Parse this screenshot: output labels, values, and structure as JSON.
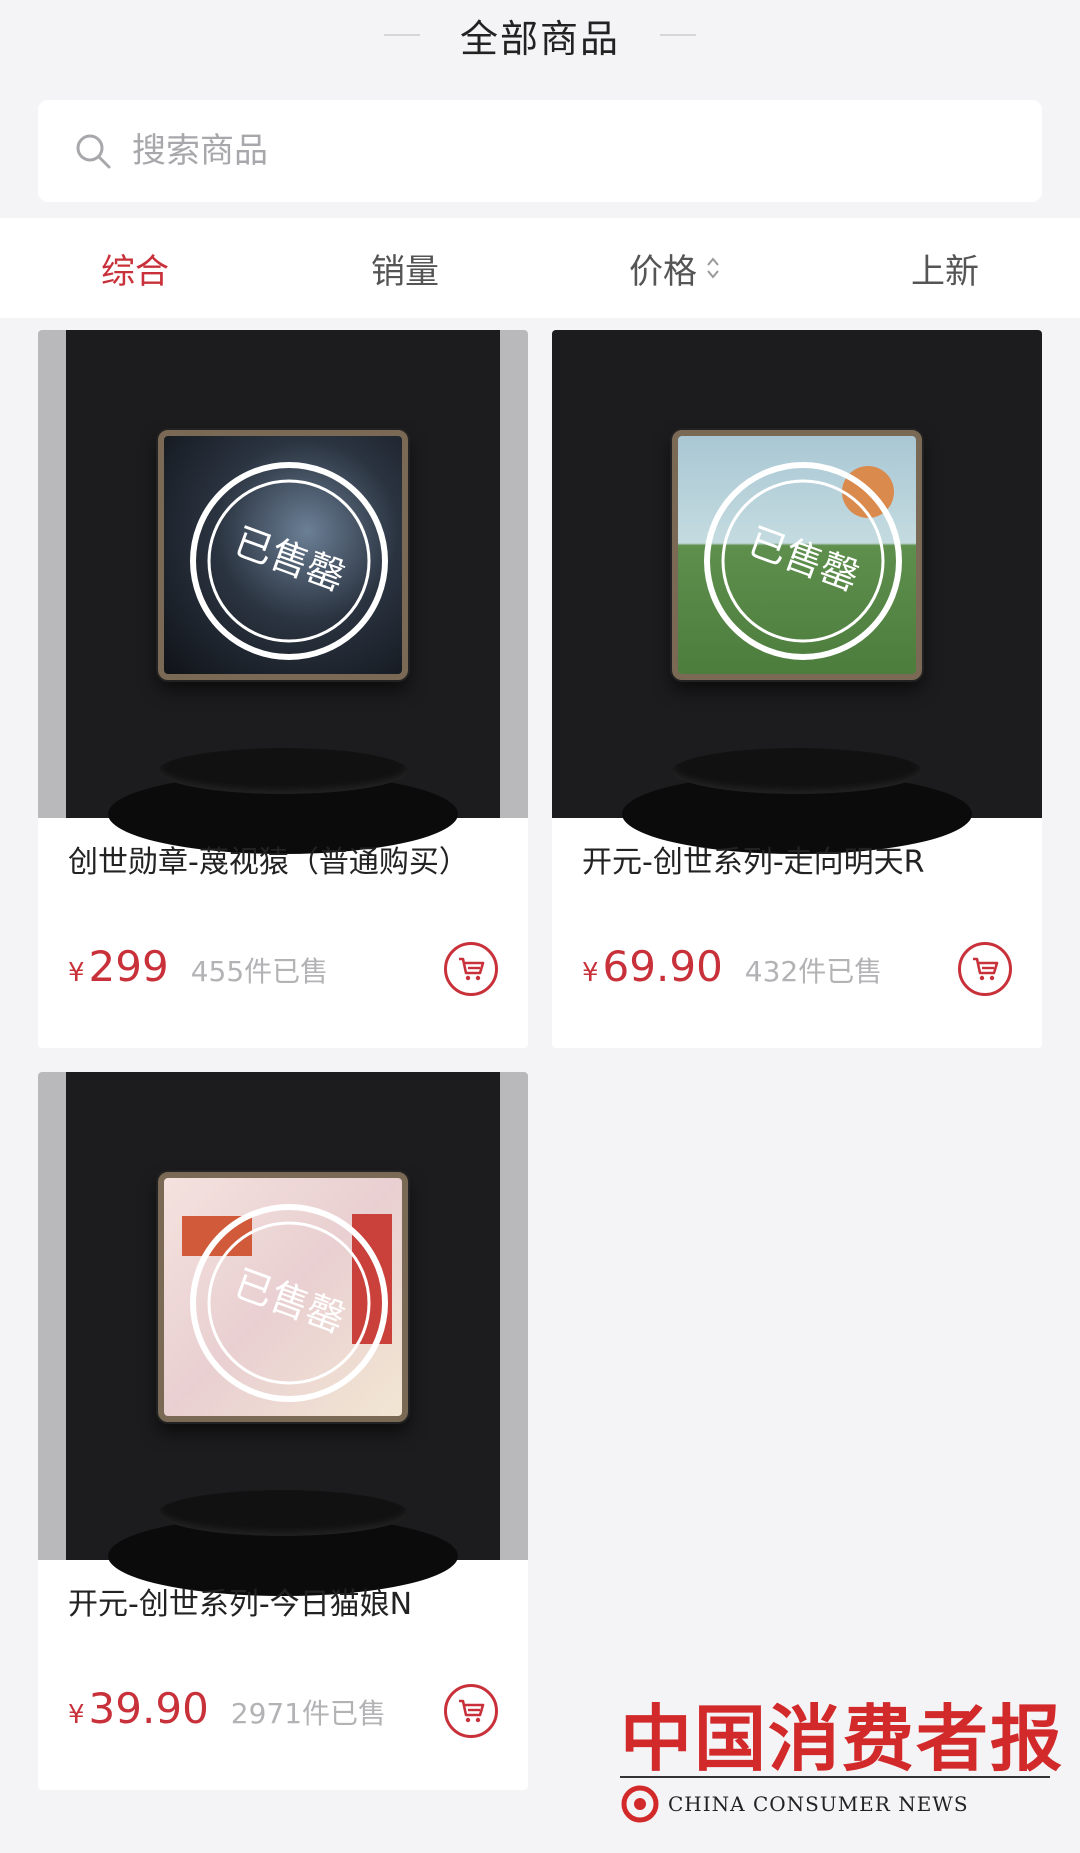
{
  "header": {
    "title": "全部商品"
  },
  "search": {
    "placeholder": "搜索商品"
  },
  "tabs": [
    {
      "label": "综合",
      "active": true
    },
    {
      "label": "销量",
      "active": false
    },
    {
      "label": "价格",
      "active": false,
      "sortable": true
    },
    {
      "label": "上新",
      "active": false
    }
  ],
  "products": [
    {
      "name": "创世勋章-蔑视猿（普通购买）",
      "currency": "¥",
      "price": "299",
      "sold": "455件已售",
      "stamp": "已售罄"
    },
    {
      "name": "开元-创世系列-走向明天R",
      "currency": "¥",
      "price": "69.90",
      "sold": "432件已售",
      "stamp": "已售罄"
    },
    {
      "name": "开元-创世系列-今日猫娘N",
      "currency": "¥",
      "price": "39.90",
      "sold": "2971件已售",
      "stamp": "已售罄"
    }
  ],
  "watermark": {
    "cn": "中国消费者报",
    "en": "CHINA CONSUMER NEWS"
  },
  "colors": {
    "accent": "#c9313a",
    "background": "#f4f4f6",
    "muted": "#b3b3b6"
  },
  "icons": {
    "search": "search-icon",
    "sort": "sort-arrows-icon",
    "cart": "cart-icon"
  }
}
